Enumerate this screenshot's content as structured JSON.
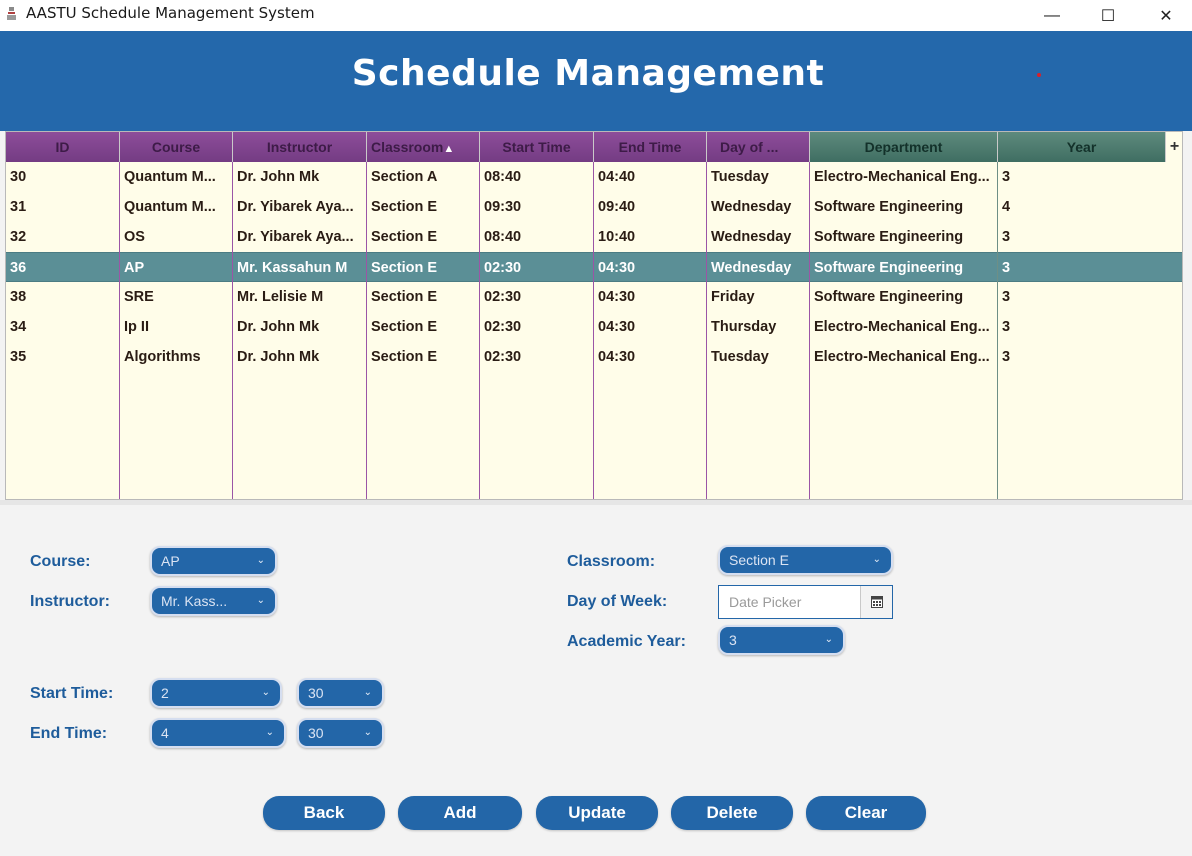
{
  "window": {
    "title": "AASTU Schedule Management System",
    "controls": {
      "minimize": "—",
      "maximize": "☐",
      "close": "✕"
    }
  },
  "header": {
    "title": "Schedule Management"
  },
  "table": {
    "columns": [
      "ID",
      "Course",
      "Instructor",
      "Classroom",
      "Start Time",
      "End Time",
      "Day of ...",
      "Department",
      "Year"
    ],
    "sort_indicator": "▲",
    "corner_button": "+",
    "rows": [
      [
        "30",
        "Quantum M...",
        "Dr. John Mk",
        "Section A",
        "08:40",
        "04:40",
        "Tuesday",
        "Electro-Mechanical Eng...",
        "3"
      ],
      [
        "31",
        "Quantum M...",
        "Dr. Yibarek Aya...",
        "Section E",
        "09:30",
        "09:40",
        "Wednesday",
        "Software Engineering",
        "4"
      ],
      [
        "32",
        "OS",
        "Dr. Yibarek Aya...",
        "Section E",
        "08:40",
        "10:40",
        "Wednesday",
        "Software Engineering",
        "3"
      ],
      [
        "36",
        "AP",
        "Mr. Kassahun M",
        "Section E",
        "02:30",
        "04:30",
        "Wednesday",
        "Software Engineering",
        "3"
      ],
      [
        "38",
        "SRE",
        "Mr. Lelisie M",
        "Section E",
        "02:30",
        "04:30",
        "Friday",
        "Software Engineering",
        "3"
      ],
      [
        "34",
        "Ip II",
        "Dr. John Mk",
        "Section E",
        "02:30",
        "04:30",
        "Thursday",
        "Electro-Mechanical Eng...",
        "3"
      ],
      [
        "35",
        "Algorithms",
        "Dr. John Mk",
        "Section E",
        "02:30",
        "04:30",
        "Tuesday",
        "Electro-Mechanical Eng...",
        "3"
      ]
    ],
    "selected_row": 3
  },
  "form": {
    "course": {
      "label": "Course:",
      "value": "AP"
    },
    "instructor": {
      "label": "Instructor:",
      "value": "Mr. Kass..."
    },
    "classroom": {
      "label": "Classroom:",
      "value": "Section E"
    },
    "day_of_week": {
      "label": "Day of Week:",
      "placeholder": "Date Picker"
    },
    "academic_year": {
      "label": "Academic Year:",
      "value": "3"
    },
    "start_time": {
      "label": "Start Time:",
      "hour": "2",
      "minute": "30"
    },
    "end_time": {
      "label": "End Time:",
      "hour": "4",
      "minute": "30"
    }
  },
  "buttons": {
    "back": "Back",
    "add": "Add",
    "update": "Update",
    "delete": "Delete",
    "clear": "Clear"
  },
  "colors": {
    "header_bg": "#2468ab",
    "column_header_purple": "#7f4590",
    "column_header_green": "#4b7a6d",
    "row_bg": "#fffde9",
    "selected_row_bg": "#5b8f96",
    "button_bg": "#2366a8",
    "label_color": "#1e5c9b"
  }
}
